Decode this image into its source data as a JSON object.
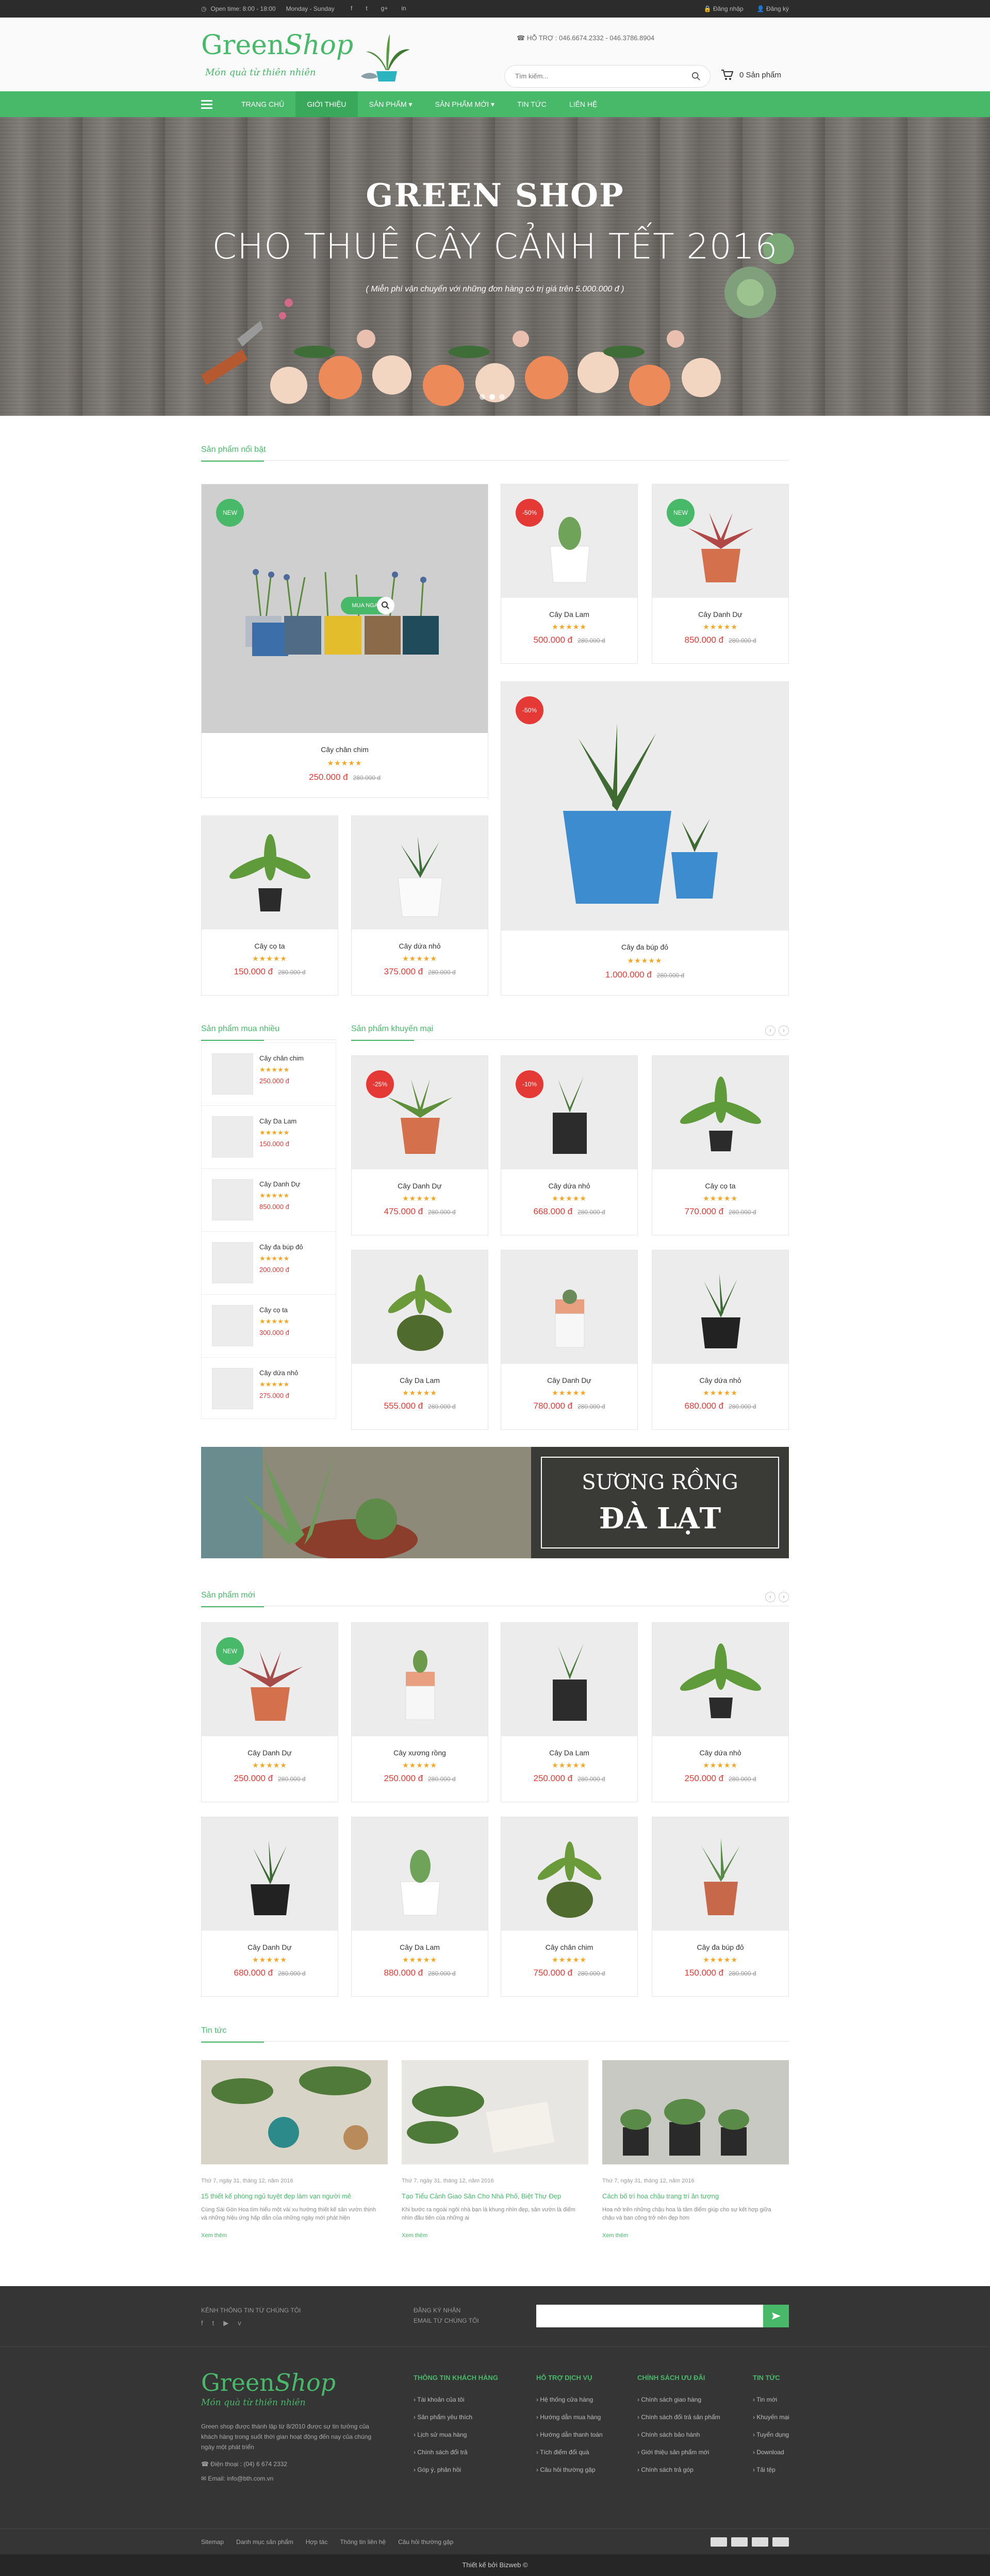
{
  "topbar": {
    "hours": "Open time: 8:00 - 18:00",
    "days": "Monday - Sunday",
    "social": [
      "f",
      "t",
      "g+",
      "in"
    ],
    "login": "Đăng nhập",
    "register": "Đăng ký"
  },
  "header": {
    "logo_green": "Green",
    "logo_shop": "Shop",
    "tagline": "Món quà từ thiên nhiên",
    "hotline": "HỖ TRỢ : 046.6674.2332 - 046.3786.8904",
    "search_placeholder": "Tìm kiếm...",
    "cart": "0 Sản phẩm"
  },
  "nav": {
    "items": [
      "TRANG CHỦ",
      "GIỚI THIỆU",
      "SẢN PHẨM ▾",
      "SẢN PHẨM MỚI ▾",
      "TIN TỨC",
      "LIÊN HỆ"
    ]
  },
  "slider": {
    "title": "GREEN SHOP",
    "subtitle": "CHO THUÊ CÂY CẢNH TẾT 2016",
    "caption": "( Miễn phí vận chuyển với những đơn hàng có trị giá trên 5.000.000 đ )"
  },
  "featured": {
    "title": "Sản phẩm nổi bật",
    "buy_now": "MUA NGAY",
    "products": [
      {
        "badge": "NEW",
        "name": "Cây chân chim",
        "price": "250.000 đ",
        "old": "280.000 đ"
      },
      {
        "badge": "-50%",
        "name": "Cây Da Lam",
        "price": "500.000 đ",
        "old": "280.000 đ"
      },
      {
        "badge": "NEW",
        "name": "Cây Danh Dự",
        "price": "850.000 đ",
        "old": "280.000 đ"
      },
      {
        "badge": "-50%",
        "name": "Cây đa búp đỏ",
        "price": "1.000.000 đ",
        "old": "280.000 đ"
      },
      {
        "badge": "",
        "name": "Cây cọ ta",
        "price": "150.000 đ",
        "old": "280.000 đ"
      },
      {
        "badge": "",
        "name": "Cây dứa nhỏ",
        "price": "375.000 đ",
        "old": "280.000 đ"
      }
    ]
  },
  "bestsellers": {
    "title": "Sản phẩm mua nhiều",
    "items": [
      {
        "name": "Cây chân chim",
        "price": "250.000 đ"
      },
      {
        "name": "Cây Da Lam",
        "price": "150.000 đ"
      },
      {
        "name": "Cây Danh Dự",
        "price": "850.000 đ"
      },
      {
        "name": "Cây đa búp đỏ",
        "price": "200.000 đ"
      },
      {
        "name": "Cây cọ ta",
        "price": "300.000 đ"
      },
      {
        "name": "Cây dứa nhỏ",
        "price": "275.000 đ"
      }
    ]
  },
  "promo": {
    "title": "Sản phẩm khuyến mại",
    "products": [
      {
        "badge": "-25%",
        "name": "Cây Danh Dự",
        "price": "475.000 đ",
        "old": "280.000 đ"
      },
      {
        "badge": "-10%",
        "name": "Cây dứa nhỏ",
        "price": "668.000 đ",
        "old": "280.000 đ"
      },
      {
        "badge": "",
        "name": "Cây cọ ta",
        "price": "770.000 đ",
        "old": "280.000 đ"
      },
      {
        "badge": "",
        "name": "Cây Da Lam",
        "price": "555.000 đ",
        "old": "280.000 đ"
      },
      {
        "badge": "",
        "name": "Cây Danh Dự",
        "price": "780.000 đ",
        "old": "280.000 đ"
      },
      {
        "badge": "",
        "name": "Cây dứa nhỏ",
        "price": "680.000 đ",
        "old": "280.000 đ"
      }
    ]
  },
  "banner": {
    "line1": "SƯƠNG RỒNG",
    "line2": "ĐÀ LẠT"
  },
  "newprod": {
    "title": "Sản phẩm mới",
    "products": [
      {
        "badge": "NEW",
        "name": "Cây Danh Dự",
        "price": "250.000 đ",
        "old": "280.000 đ"
      },
      {
        "badge": "",
        "name": "Cây xương rồng",
        "price": "250.000 đ",
        "old": "280.000 đ"
      },
      {
        "badge": "",
        "name": "Cây Da Lam",
        "price": "250.000 đ",
        "old": "280.000 đ"
      },
      {
        "badge": "",
        "name": "Cây dứa nhỏ",
        "price": "250.000 đ",
        "old": "280.000 đ"
      },
      {
        "badge": "",
        "name": "Cây Danh Dự",
        "price": "680.000 đ",
        "old": "280.000 đ"
      },
      {
        "badge": "",
        "name": "Cây Da Lam",
        "price": "880.000 đ",
        "old": "280.000 đ"
      },
      {
        "badge": "",
        "name": "Cây chân chim",
        "price": "750.000 đ",
        "old": "280.000 đ"
      },
      {
        "badge": "",
        "name": "Cây đa búp đỏ",
        "price": "150.000 đ",
        "old": "280.000 đ"
      }
    ]
  },
  "news": {
    "title": "Tin tức",
    "items": [
      {
        "date": "Thứ 7, ngày 31, tháng 12, năm 2016",
        "title": "15 thiết kế phòng ngủ tuyệt đẹp làm vạn người mê",
        "desc": "Cùng Sài Gòn Hoa tìm hiểu một vài xu hướng thiết kế sân vườn thịnh và những hiệu ứng hấp dẫn của những ngày mới phát hiện",
        "more": "Xem thêm"
      },
      {
        "date": "Thứ 7, ngày 31, tháng 12, năm 2016",
        "title": "Tạo Tiểu Cảnh Giao Sân Cho Nhà Phố, Biệt Thự Đẹp",
        "desc": "Khi bước ra ngoài ngôi nhà bạn là khung nhìn đẹp, sân vườn là điểm nhìn đầu tiên của những ai",
        "more": "Xem thêm"
      },
      {
        "date": "Thứ 7, ngày 31, tháng 12, năm 2016",
        "title": "Cách bố trí hoa chậu trang trí ăn tượng",
        "desc": "Hoa nở trên những chậu hoa là tâm điểm giúp cho sự kết hợp giữa chậu và ban công trở nên đẹp hơn",
        "more": "Xem thêm"
      }
    ]
  },
  "footer": {
    "follow": "KÊNH THÔNG TIN TỪ CHÚNG TÔI",
    "newsletter1": "ĐĂNG KÝ NHẬN",
    "newsletter2": "EMAIL TỪ CHÚNG TÔI",
    "about": "Green shop được thành lập từ 8/2010 được sự tin tưởng của khách hàng trong suốt thời gian hoạt động đến nay của chúng ngày một phát triển",
    "phone": "Điện thoại : (04) 6 674 2332",
    "email": "Email: info@bth.com.vn",
    "col1": {
      "title": "THÔNG TIN KHÁCH HÀNG",
      "items": [
        "Tài khoản của tôi",
        "Sản phẩm yêu thích",
        "Lịch sử mua hàng",
        "Chính sách đổi trả",
        "Góp ý, phản hồi"
      ]
    },
    "col2": {
      "title": "HỖ TRỢ DỊCH VỤ",
      "items": [
        "Hệ thống cửa hàng",
        "Hướng dẫn mua hàng",
        "Hướng dẫn thanh toán",
        "Tích điểm đổi quà",
        "Câu hỏi thường gặp"
      ]
    },
    "col3": {
      "title": "CHÍNH SÁCH ƯU ĐÃI",
      "items": [
        "Chính sách giao hàng",
        "Chính sách đổi trả sản phẩm",
        "Chính sách bảo hành",
        "Giới thiệu sản phẩm mới",
        "Chính sách trả góp"
      ]
    },
    "col4": {
      "title": "TIN TỨC",
      "items": [
        "Tin mới",
        "Khuyến mại",
        "Tuyển dụng",
        "Download",
        "Tải tệp"
      ]
    },
    "links": [
      "Sitemap",
      "Danh mục sản phẩm",
      "Hợp tác",
      "Thông tin liên hệ",
      "Câu hỏi thường gặp"
    ],
    "copyright": "Thiết kế bởi Bizweb ©"
  }
}
